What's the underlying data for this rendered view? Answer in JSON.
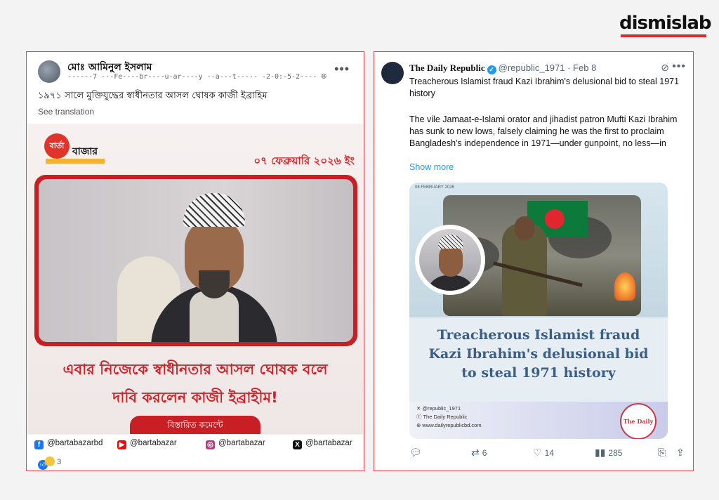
{
  "brand": {
    "name": "dismislab",
    "accent": "#e12b2b"
  },
  "facebook_post": {
    "author": "মোঃ আমিনুল ইসলাম",
    "meta": "------7 ---Fe----br----u-ar----y --a---t----- -2-0:-5-2----",
    "visibility_icon": "globe-icon",
    "more_label": "•••",
    "caption": "১৯৭১ সালে মুক্তিযুদ্ধের স্বাধীনতার আসল ঘোষক কাজী ইব্রাহিম",
    "see_translation": "See translation",
    "card": {
      "logo_text": "বার্তা",
      "logo_name": "বাজার",
      "date": "০৭ ফেব্রুয়ারি ২০২৬ ইং",
      "headline_line1": "এবার নিজেকে স্বাধীনতার আসল ঘোষক বলে",
      "headline_line2": "দাবি করলেন কাজী ইব্রাহীম!",
      "cta": "বিস্তারিত কমেন্টে"
    },
    "socials": [
      {
        "icon": "facebook-icon",
        "glyph": "f",
        "color": "#1877f2",
        "handle": "@bartabazarbd"
      },
      {
        "icon": "youtube-icon",
        "glyph": "▶",
        "color": "#ff0000",
        "handle": "@bartabazar"
      },
      {
        "icon": "instagram-icon",
        "glyph": "◎",
        "color": "#c13584",
        "handle": "@bartabazar"
      },
      {
        "icon": "x-icon",
        "glyph": "X",
        "color": "#111111",
        "handle": "@bartabazar"
      }
    ],
    "reactions_count": "3"
  },
  "x_post": {
    "display_name": "The Daily Republic",
    "handle_time": "@republic_1971 · Feb 8",
    "title": "Treacherous Islamist fraud Kazi Ibrahim's delusional bid to steal 1971 history",
    "body": "The vile Jamaat-e-Islami orator and jihadist patron Mufti Kazi Ibrahim has sunk to new lows, falsely claiming he was the first to proclaim Bangladesh's independence in 1971—under gunpoint, no less—in",
    "show_more": "Show more",
    "media": {
      "date_label": "08 FEBRUARY 2026",
      "headline_line1": "Treacherous Islamist fraud",
      "headline_line2": "Kazi Ibrahim's delusional bid",
      "headline_line3": "to steal 1971 history",
      "link_x": "@republic_1971",
      "link_fb": "The Daily Republic",
      "link_web": "www.dailyrepublicbd.com",
      "logo_text": "The Daily Republic"
    },
    "actions": {
      "reply": "",
      "repost": "6",
      "like": "14",
      "views": "285"
    },
    "accent": "#1d9bf0"
  }
}
